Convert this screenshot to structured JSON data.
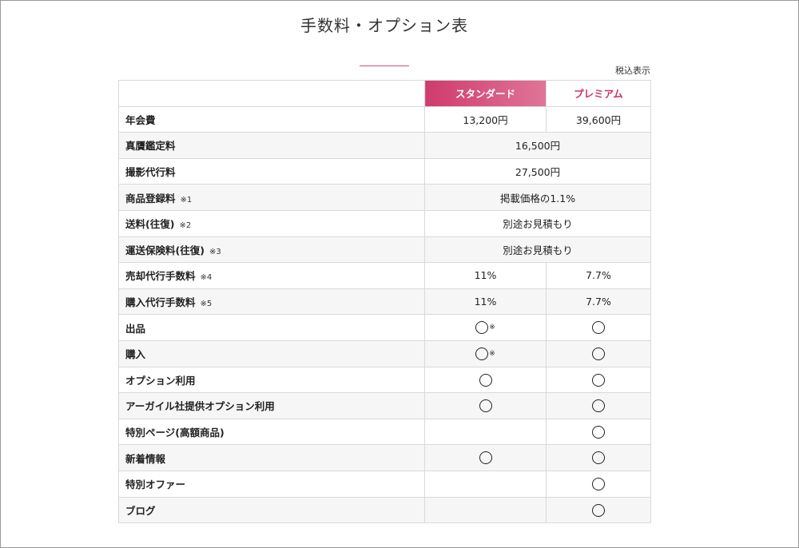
{
  "page": {
    "title": "手数料・オプション表",
    "tax_note": "税込表示",
    "accent_color": "#d94b7a"
  },
  "table": {
    "headers": {
      "label": "",
      "standard": "スタンダード",
      "premium": "プレミアム"
    },
    "rows": [
      {
        "label": "年会費",
        "note": "",
        "standard": "13,200円",
        "premium": "39,600円"
      },
      {
        "label": "真贋鑑定料",
        "note": "",
        "shared": "16,500円"
      },
      {
        "label": "撮影代行料",
        "note": "",
        "shared": "27,500円"
      },
      {
        "label": "商品登録料",
        "note": "※1",
        "shared": "掲載価格の1.1%"
      },
      {
        "label": "送料(往復)",
        "note": "※2",
        "shared": "別途お見積もり"
      },
      {
        "label": "運送保険料(往復)",
        "note": "※3",
        "shared": "別途お見積もり"
      },
      {
        "label": "売却代行手数料",
        "note": "※4",
        "standard": "11%",
        "premium": "7.7%"
      },
      {
        "label": "購入代行手数料",
        "note": "※5",
        "standard": "11%",
        "premium": "7.7%"
      },
      {
        "label": "出品",
        "note": "",
        "standard": "circle",
        "standard_mark": "※",
        "premium": "circle"
      },
      {
        "label": "購入",
        "note": "",
        "standard": "circle",
        "standard_mark": "※",
        "premium": "circle"
      },
      {
        "label": "オプション利用",
        "note": "",
        "standard": "circle",
        "premium": "circle"
      },
      {
        "label": "アーガイル社提供オプション利用",
        "note": "",
        "standard": "circle",
        "premium": "circle"
      },
      {
        "label": "特別ページ(高額商品)",
        "note": "",
        "standard": "",
        "premium": "circle"
      },
      {
        "label": "新着情報",
        "note": "",
        "standard": "circle",
        "premium": "circle"
      },
      {
        "label": "特別オファー",
        "note": "",
        "standard": "",
        "premium": "circle"
      },
      {
        "label": "ブログ",
        "note": "",
        "standard": "",
        "premium": "circle"
      }
    ]
  }
}
